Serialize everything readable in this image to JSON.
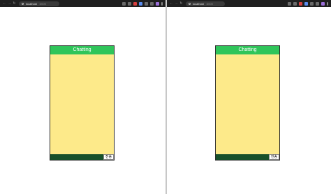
{
  "windows": [
    {
      "url_host": "localhost",
      "url_port": ":3000",
      "nav_icons": [
        "←",
        "→",
        "↻"
      ],
      "app": {
        "title": "Chatting",
        "input_value": "",
        "send_label": "전송"
      }
    },
    {
      "url_host": "localhost",
      "url_port": ":3000",
      "nav_icons": [
        "←",
        "→",
        "↻"
      ],
      "app": {
        "title": "Chatting",
        "input_value": "",
        "send_label": "전송"
      }
    }
  ],
  "colors": {
    "header": "#2fc55a",
    "chat_background": "#fdea8a",
    "input_background": "#17502a",
    "browser_toolbar": "#1f1f1f"
  }
}
